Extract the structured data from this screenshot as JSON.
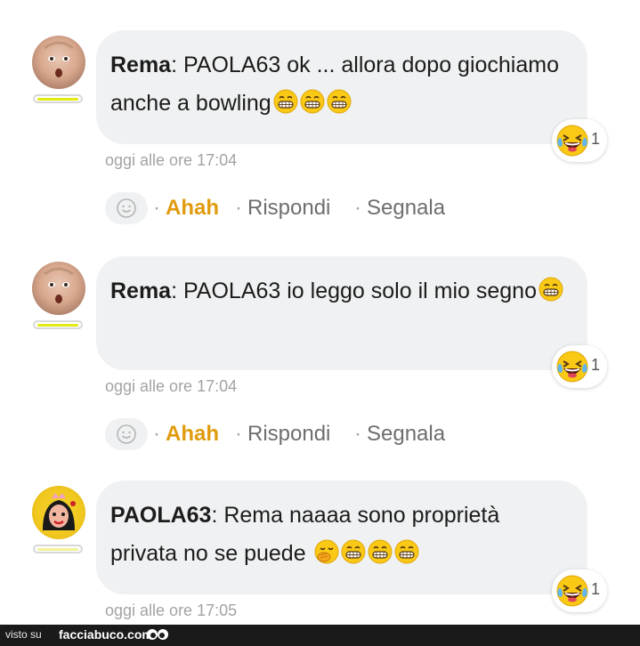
{
  "comments": [
    {
      "author": "Rema",
      "text": ": PAOLA63 ok ... allora dopo giochiamo anche a bowling",
      "inline_emojis": [
        "grin-emoji",
        "grin-emoji",
        "grin-emoji"
      ],
      "reaction_emoji": "laugh-tears-emoji",
      "reaction_count": "1",
      "timestamp": "oggi alle ore 17:04",
      "level_color": "#e2ea12",
      "avatar": "baby-face-avatar",
      "actions": {
        "react_icon": "smiley-icon",
        "ahah": "Ahah",
        "reply": "Rispondi",
        "report": "Segnala"
      }
    },
    {
      "author": "Rema",
      "text": ": PAOLA63 io leggo solo il mio segno",
      "inline_emojis": [
        "grin-emoji"
      ],
      "reaction_emoji": "laugh-tears-emoji",
      "reaction_count": "1",
      "timestamp": "oggi alle ore 17:04",
      "level_color": "#e2ea12",
      "avatar": "baby-face-avatar",
      "actions": {
        "react_icon": "smiley-icon",
        "ahah": "Ahah",
        "reply": "Rispondi",
        "report": "Segnala"
      }
    },
    {
      "author": "PAOLA63",
      "text": ": Rema naaaa sono proprietà privata no se puede",
      "inline_emojis": [
        "hand-over-mouth-emoji",
        "grin-emoji",
        "grin-emoji",
        "grin-emoji"
      ],
      "reaction_emoji": "laugh-tears-emoji",
      "reaction_count": "1",
      "timestamp": "oggi alle ore 17:05",
      "level_color": "#f2f29a",
      "avatar": "pop-art-queen-avatar"
    }
  ],
  "footer": {
    "prefix": "visto su",
    "site": "facciabuco.com"
  },
  "colors": {
    "accent_ahah": "#e09b0e",
    "bubble": "#f0f1f2",
    "timestamp": "#a3a3a3"
  }
}
